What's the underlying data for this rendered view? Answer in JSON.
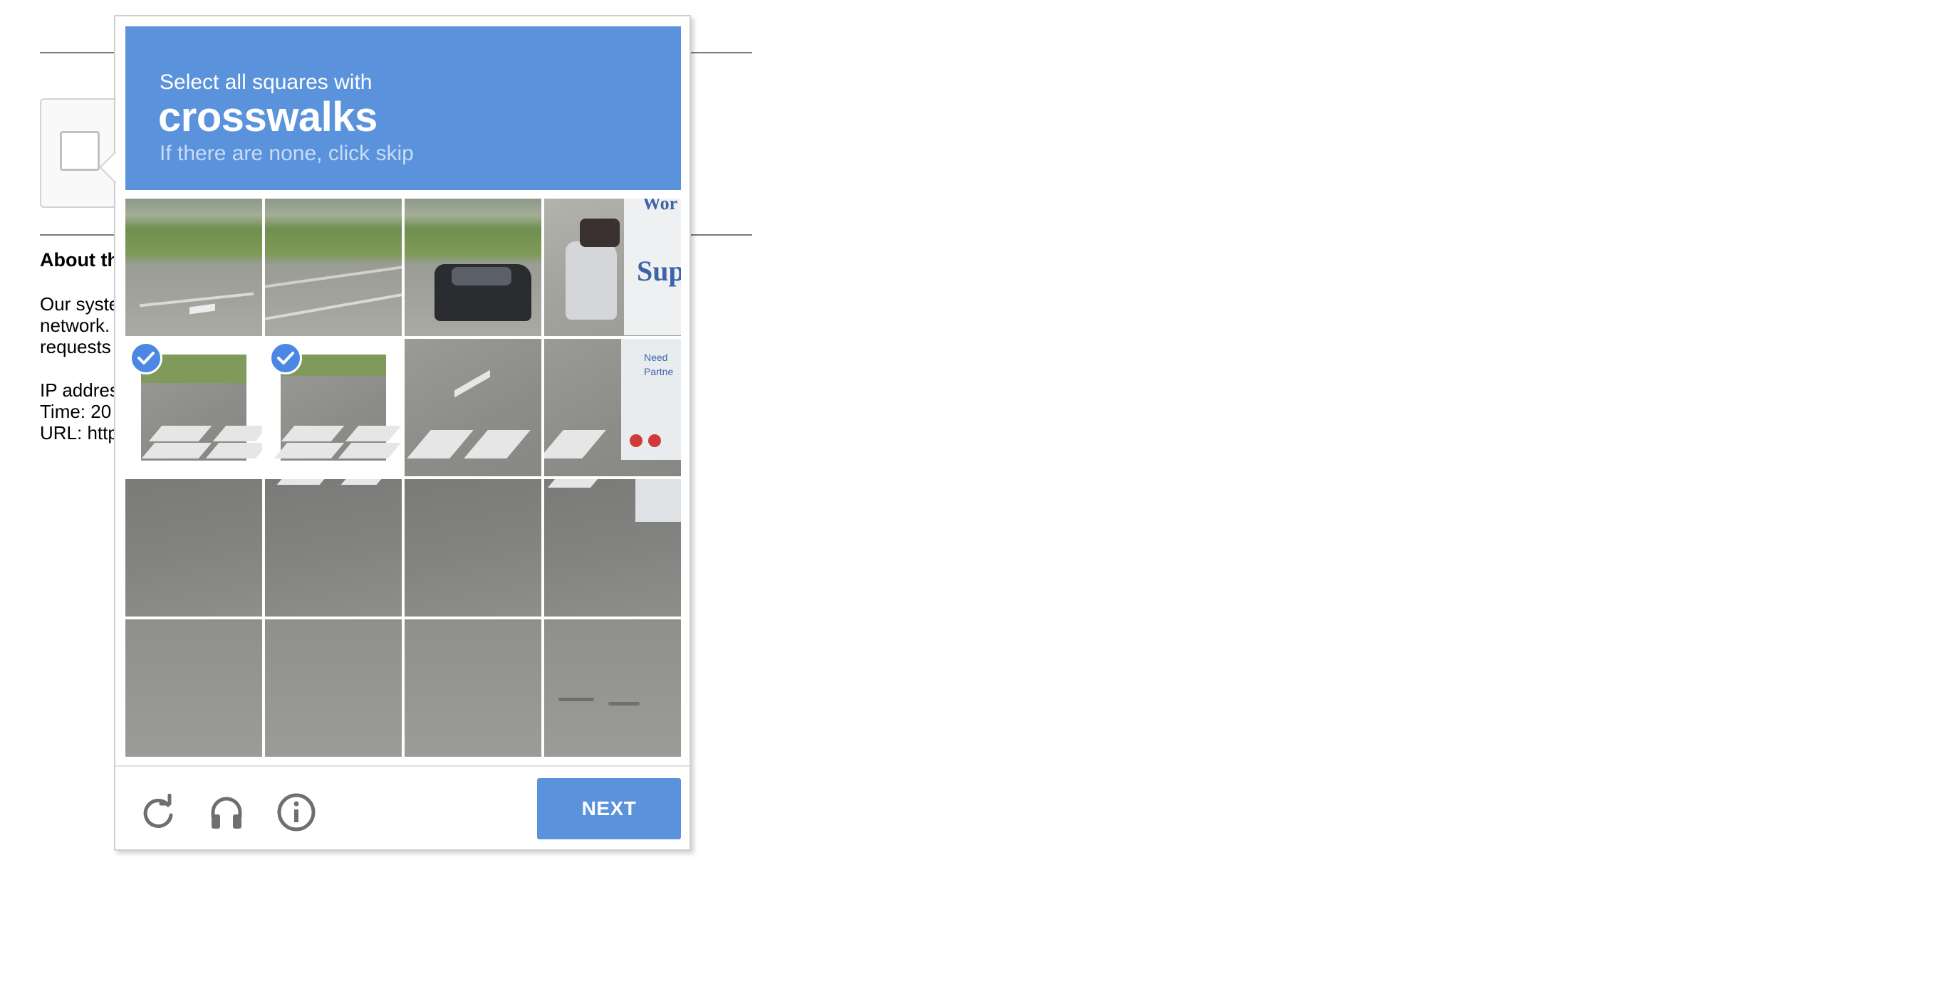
{
  "background_page": {
    "about_title": "About th",
    "body_lines": [
      "Our syste",
      "network.",
      "requests"
    ],
    "info_lines": [
      "IP addres",
      "Time: 20",
      "URL: http"
    ]
  },
  "captcha": {
    "instruction": "Select all squares with",
    "keyword": "crosswalks",
    "hint": "If there are none, click skip",
    "tiles": [
      {
        "row": 1,
        "col": 1,
        "selected": false
      },
      {
        "row": 1,
        "col": 2,
        "selected": false
      },
      {
        "row": 1,
        "col": 3,
        "selected": false
      },
      {
        "row": 1,
        "col": 4,
        "selected": false
      },
      {
        "row": 2,
        "col": 1,
        "selected": true
      },
      {
        "row": 2,
        "col": 2,
        "selected": true
      },
      {
        "row": 2,
        "col": 3,
        "selected": false
      },
      {
        "row": 2,
        "col": 4,
        "selected": false
      },
      {
        "row": 3,
        "col": 1,
        "selected": false
      },
      {
        "row": 3,
        "col": 2,
        "selected": false
      },
      {
        "row": 3,
        "col": 3,
        "selected": false
      },
      {
        "row": 3,
        "col": 4,
        "selected": false
      },
      {
        "row": 4,
        "col": 1,
        "selected": false
      },
      {
        "row": 4,
        "col": 2,
        "selected": false
      },
      {
        "row": 4,
        "col": 3,
        "selected": false
      },
      {
        "row": 4,
        "col": 4,
        "selected": false
      }
    ],
    "truck_text": {
      "top": "Wor",
      "middle": "Sup",
      "small1": "Need",
      "small2": "Partne"
    },
    "footer": {
      "icons": [
        "reload-icon",
        "headphones-icon",
        "info-icon"
      ],
      "next_label": "NEXT"
    },
    "colors": {
      "accent": "#5b92dc",
      "check": "#4a88e3"
    }
  }
}
